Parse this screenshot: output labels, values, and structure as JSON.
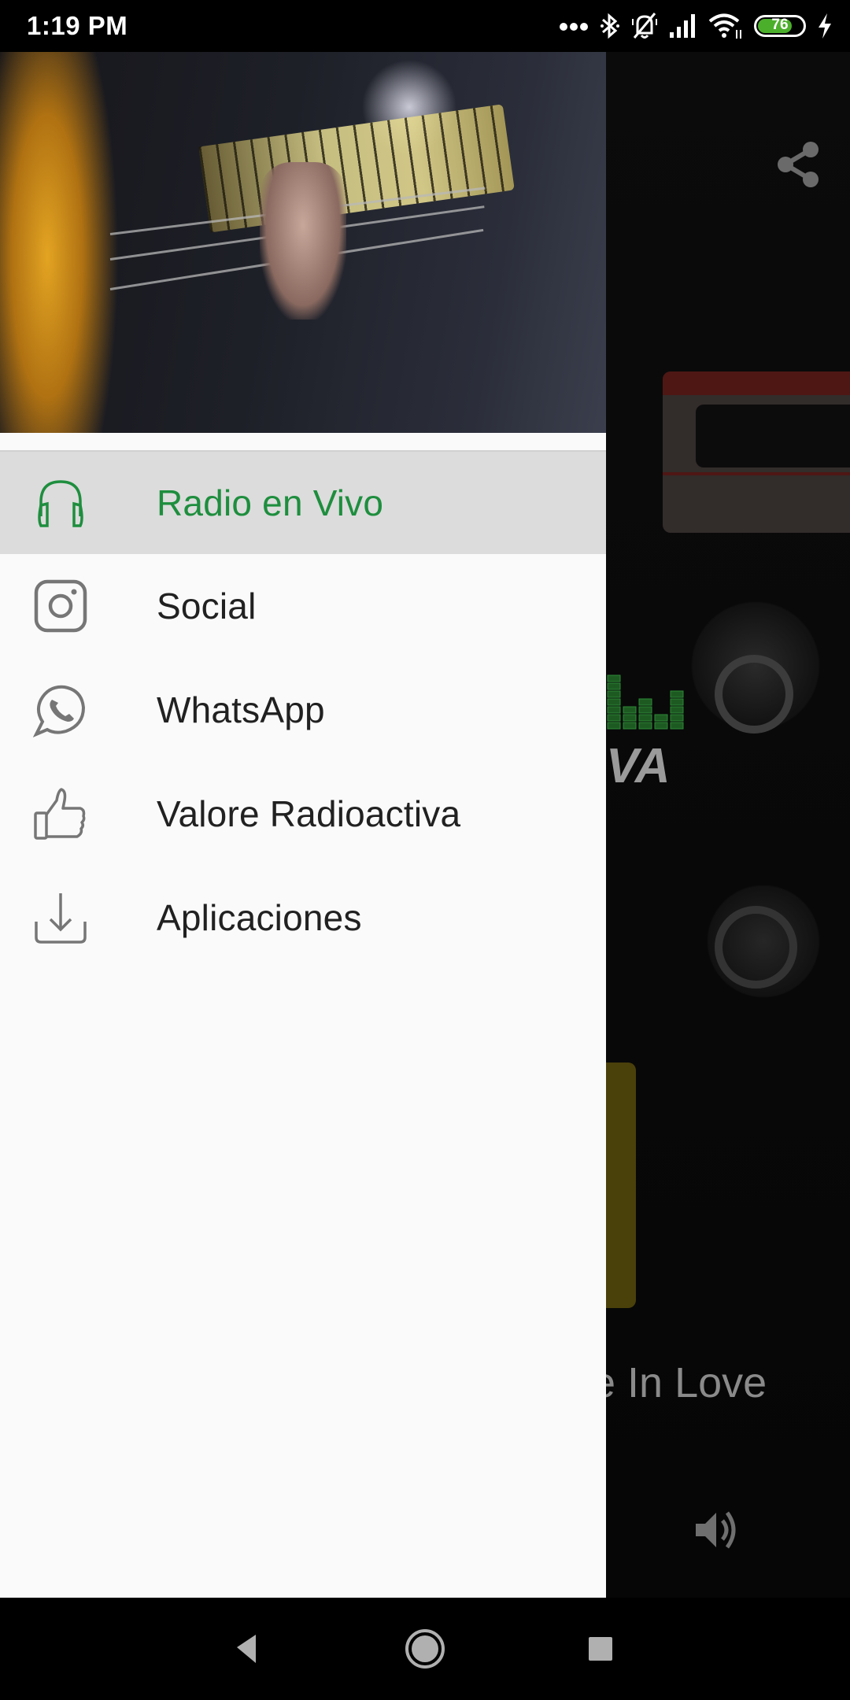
{
  "status_bar": {
    "time": "1:19 PM",
    "icons": [
      "more-dots-icon",
      "bluetooth-icon",
      "notifications-off-icon",
      "signal-icon",
      "wifi-icon",
      "battery-icon",
      "charging-icon"
    ],
    "battery_level": "76",
    "battery_color": "#4caf2c"
  },
  "background_app": {
    "song_title_partial": "e In Love",
    "logo_partial": "VA",
    "share_icon": "share-icon",
    "volume_icon": "volume-icon"
  },
  "drawer": {
    "header_image": "bass-guitar-photo",
    "accent_color": "#1e8e3e",
    "selected_index": 0,
    "items": [
      {
        "label": "Radio en Vivo",
        "icon": "headphones-icon",
        "selected": true
      },
      {
        "label": "Social",
        "icon": "instagram-icon",
        "selected": false
      },
      {
        "label": "WhatsApp",
        "icon": "whatsapp-icon",
        "selected": false
      },
      {
        "label": "Valore Radioactiva",
        "icon": "thumbs-up-icon",
        "selected": false
      },
      {
        "label": "Aplicaciones",
        "icon": "download-icon",
        "selected": false
      }
    ]
  },
  "nav_bar": {
    "back": "back-icon",
    "home": "home-icon",
    "recents": "recents-icon"
  }
}
